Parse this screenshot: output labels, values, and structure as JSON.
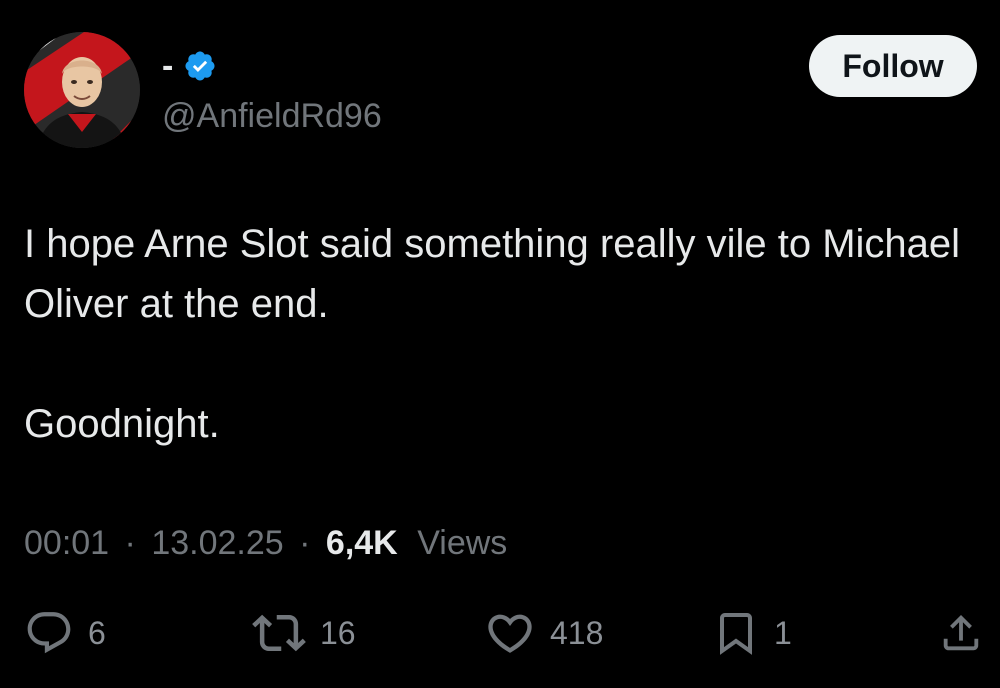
{
  "author": {
    "display_name": "-",
    "handle": "@AnfieldRd96",
    "verified": true,
    "avatar_icon": "cartoon-portrait-avatar"
  },
  "follow_button": {
    "label": "Follow"
  },
  "tweet": {
    "paragraphs": [
      "I hope Arne Slot said something really vile to Michael Oliver at the end.",
      "Goodnight."
    ]
  },
  "meta": {
    "time": "00:01",
    "separator": "·",
    "date": "13.02.25",
    "views_count": "6,4K",
    "views_label": "Views"
  },
  "actions": {
    "replies": {
      "icon": "reply-icon",
      "count": "6"
    },
    "reposts": {
      "icon": "repost-icon",
      "count": "16"
    },
    "likes": {
      "icon": "heart-icon",
      "count": "418"
    },
    "bookmarks": {
      "icon": "bookmark-icon",
      "count": "1"
    },
    "share": {
      "icon": "share-icon"
    }
  },
  "colors": {
    "background": "#000000",
    "primary_text": "#e7e9ea",
    "secondary_text": "#71767b",
    "verified_blue": "#1d9bf0",
    "follow_bg": "#eff3f4",
    "follow_text": "#0f1419"
  }
}
